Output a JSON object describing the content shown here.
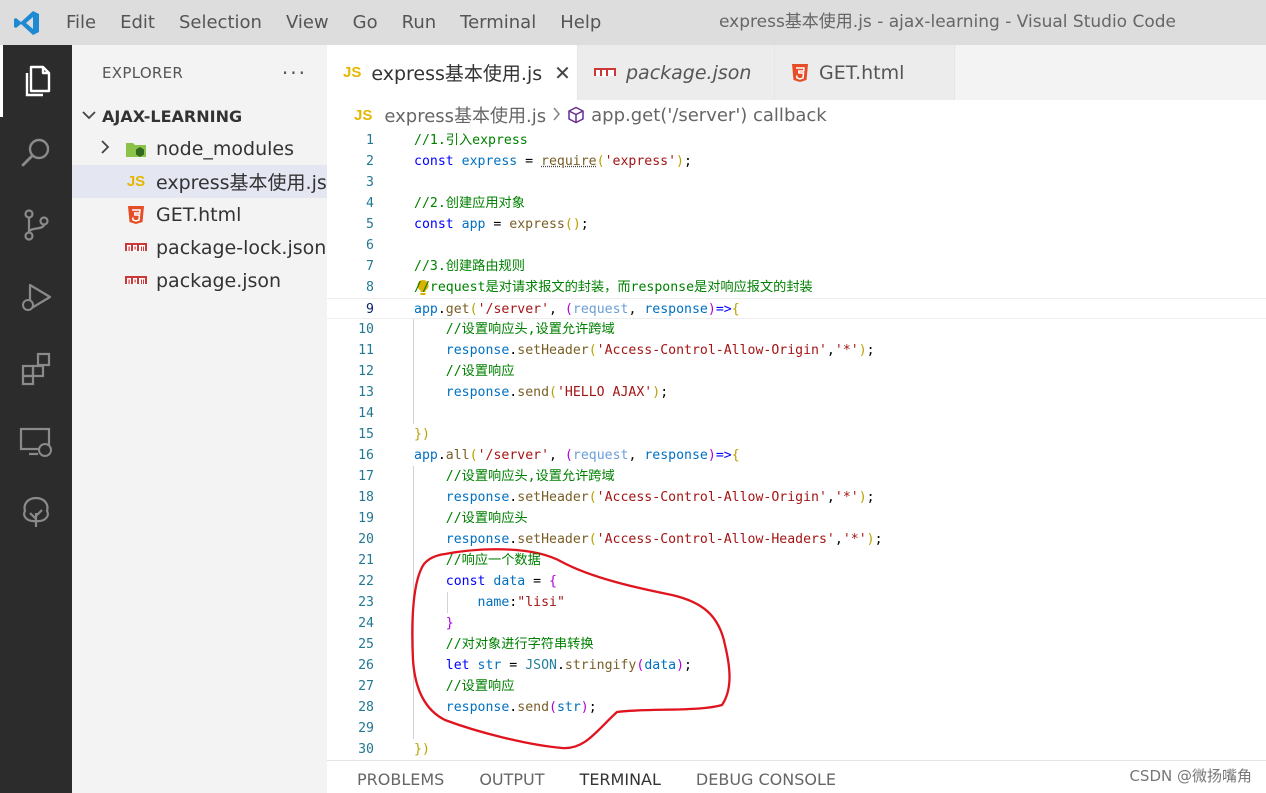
{
  "titlebar": {
    "menu": [
      "File",
      "Edit",
      "Selection",
      "View",
      "Go",
      "Run",
      "Terminal",
      "Help"
    ],
    "window_title": "express基本使用.js - ajax-learning - Visual Studio Code"
  },
  "activitybar": {
    "icons": [
      "explorer-icon",
      "search-icon",
      "source-control-icon",
      "run-debug-icon",
      "extensions-icon",
      "remote-explorer-icon",
      "tree-icon"
    ]
  },
  "sidebar": {
    "title": "EXPLORER",
    "more": "···",
    "folder": "AJAX-LEARNING",
    "items": [
      {
        "name": "node_modules",
        "icon": "node-folder-icon"
      },
      {
        "name": "express基本使用.js",
        "icon": "js-file-icon"
      },
      {
        "name": "GET.html",
        "icon": "html5-icon"
      },
      {
        "name": "package-lock.json",
        "icon": "npm-icon"
      },
      {
        "name": "package.json",
        "icon": "npm-icon"
      }
    ]
  },
  "tabs": [
    {
      "label": "express基本使用.js",
      "icon": "js-file-icon",
      "close": "✕"
    },
    {
      "label": "package.json",
      "icon": "npm-icon"
    },
    {
      "label": "GET.html",
      "icon": "html5-icon"
    }
  ],
  "breadcrumb": {
    "file": "express基本使用.js",
    "symbol": "app.get('/server') callback"
  },
  "editor": {
    "current_line": 9,
    "lines": [
      {
        "n": "1",
        "tokens": [
          [
            "c",
            "//1.引入express"
          ]
        ]
      },
      {
        "n": "2",
        "tokens": [
          [
            "k",
            "const "
          ],
          [
            "v",
            "express"
          ],
          [
            "o",
            " = "
          ],
          [
            "f",
            "require"
          ],
          [
            "br",
            "("
          ],
          [
            "s",
            "'express'"
          ],
          [
            "br",
            ")"
          ],
          [
            "o",
            ";"
          ]
        ]
      },
      {
        "n": "3",
        "tokens": []
      },
      {
        "n": "4",
        "tokens": [
          [
            "c",
            "//2.创建应用对象"
          ]
        ]
      },
      {
        "n": "5",
        "tokens": [
          [
            "k",
            "const "
          ],
          [
            "v",
            "app"
          ],
          [
            "o",
            " = "
          ],
          [
            "f",
            "express"
          ],
          [
            "br",
            "()"
          ],
          [
            "o",
            ";"
          ]
        ]
      },
      {
        "n": "6",
        "tokens": []
      },
      {
        "n": "7",
        "tokens": [
          [
            "c",
            "//3.创建路由规则"
          ]
        ]
      },
      {
        "n": "8",
        "tokens": [
          [
            "c",
            "//request是对请求报文的封装，而response是对响应报文的封装"
          ]
        ]
      },
      {
        "n": "9",
        "tokens": [
          [
            "v",
            "app"
          ],
          [
            "o",
            "."
          ],
          [
            "f",
            "get"
          ],
          [
            "br",
            "("
          ],
          [
            "s",
            "'/server'"
          ],
          [
            "o",
            ", "
          ],
          [
            "bp",
            "("
          ],
          [
            "p",
            "request"
          ],
          [
            "o",
            ", "
          ],
          [
            "v",
            "response"
          ],
          [
            "bp",
            ")"
          ],
          [
            "k",
            "=>"
          ],
          [
            "br",
            "{"
          ]
        ]
      },
      {
        "n": "10",
        "tokens": [
          [
            "o",
            "    "
          ],
          [
            "c",
            "//设置响应头,设置允许跨域"
          ]
        ]
      },
      {
        "n": "11",
        "tokens": [
          [
            "o",
            "    "
          ],
          [
            "v",
            "response"
          ],
          [
            "o",
            "."
          ],
          [
            "f",
            "setHeader"
          ],
          [
            "br",
            "("
          ],
          [
            "s",
            "'Access-Control-Allow-Origin'"
          ],
          [
            "o",
            ","
          ],
          [
            "s",
            "'*'"
          ],
          [
            "br",
            ")"
          ],
          [
            "o",
            ";"
          ]
        ]
      },
      {
        "n": "12",
        "tokens": [
          [
            "o",
            "    "
          ],
          [
            "c",
            "//设置响应"
          ]
        ]
      },
      {
        "n": "13",
        "tokens": [
          [
            "o",
            "    "
          ],
          [
            "v",
            "response"
          ],
          [
            "o",
            "."
          ],
          [
            "f",
            "send"
          ],
          [
            "br",
            "("
          ],
          [
            "s",
            "'HELLO AJAX'"
          ],
          [
            "br",
            ")"
          ],
          [
            "o",
            ";"
          ]
        ]
      },
      {
        "n": "14",
        "tokens": []
      },
      {
        "n": "15",
        "tokens": [
          [
            "br",
            "})"
          ]
        ]
      },
      {
        "n": "16",
        "tokens": [
          [
            "v",
            "app"
          ],
          [
            "o",
            "."
          ],
          [
            "f",
            "all"
          ],
          [
            "br",
            "("
          ],
          [
            "s",
            "'/server'"
          ],
          [
            "o",
            ", "
          ],
          [
            "bp",
            "("
          ],
          [
            "p",
            "request"
          ],
          [
            "o",
            ", "
          ],
          [
            "v",
            "response"
          ],
          [
            "bp",
            ")"
          ],
          [
            "k",
            "=>"
          ],
          [
            "br",
            "{"
          ]
        ]
      },
      {
        "n": "17",
        "tokens": [
          [
            "o",
            "    "
          ],
          [
            "c",
            "//设置响应头,设置允许跨域"
          ]
        ]
      },
      {
        "n": "18",
        "tokens": [
          [
            "o",
            "    "
          ],
          [
            "v",
            "response"
          ],
          [
            "o",
            "."
          ],
          [
            "f",
            "setHeader"
          ],
          [
            "br",
            "("
          ],
          [
            "s",
            "'Access-Control-Allow-Origin'"
          ],
          [
            "o",
            ","
          ],
          [
            "s",
            "'*'"
          ],
          [
            "br",
            ")"
          ],
          [
            "o",
            ";"
          ]
        ]
      },
      {
        "n": "19",
        "tokens": [
          [
            "o",
            "    "
          ],
          [
            "c",
            "//设置响应头"
          ]
        ]
      },
      {
        "n": "20",
        "tokens": [
          [
            "o",
            "    "
          ],
          [
            "v",
            "response"
          ],
          [
            "o",
            "."
          ],
          [
            "f",
            "setHeader"
          ],
          [
            "br",
            "("
          ],
          [
            "s",
            "'Access-Control-Allow-Headers'"
          ],
          [
            "o",
            ","
          ],
          [
            "s",
            "'*'"
          ],
          [
            "br",
            ")"
          ],
          [
            "o",
            ";"
          ]
        ]
      },
      {
        "n": "21",
        "tokens": [
          [
            "o",
            "    "
          ],
          [
            "c",
            "//响应一个数据"
          ]
        ]
      },
      {
        "n": "22",
        "tokens": [
          [
            "o",
            "    "
          ],
          [
            "k",
            "const "
          ],
          [
            "v",
            "data"
          ],
          [
            "o",
            " = "
          ],
          [
            "bp",
            "{"
          ]
        ]
      },
      {
        "n": "23",
        "tokens": [
          [
            "o",
            "        "
          ],
          [
            "v",
            "name"
          ],
          [
            "o",
            ":"
          ],
          [
            "s",
            "\"lisi\""
          ]
        ]
      },
      {
        "n": "24",
        "tokens": [
          [
            "o",
            "    "
          ],
          [
            "bp",
            "}"
          ]
        ]
      },
      {
        "n": "25",
        "tokens": [
          [
            "o",
            "    "
          ],
          [
            "c",
            "//对对象进行字符串转换"
          ]
        ]
      },
      {
        "n": "26",
        "tokens": [
          [
            "o",
            "    "
          ],
          [
            "k",
            "let "
          ],
          [
            "v",
            "str"
          ],
          [
            "o",
            " = "
          ],
          [
            "t",
            "JSON"
          ],
          [
            "o",
            "."
          ],
          [
            "f",
            "stringify"
          ],
          [
            "bp",
            "("
          ],
          [
            "v",
            "data"
          ],
          [
            "bp",
            ")"
          ],
          [
            "o",
            ";"
          ]
        ]
      },
      {
        "n": "27",
        "tokens": [
          [
            "o",
            "    "
          ],
          [
            "c",
            "//设置响应"
          ]
        ]
      },
      {
        "n": "28",
        "tokens": [
          [
            "o",
            "    "
          ],
          [
            "v",
            "response"
          ],
          [
            "o",
            "."
          ],
          [
            "f",
            "send"
          ],
          [
            "bp",
            "("
          ],
          [
            "v",
            "str"
          ],
          [
            "bp",
            ")"
          ],
          [
            "o",
            ";"
          ]
        ]
      },
      {
        "n": "29",
        "tokens": []
      },
      {
        "n": "30",
        "tokens": [
          [
            "br",
            "})"
          ]
        ]
      }
    ]
  },
  "panel": {
    "tabs": [
      "PROBLEMS",
      "OUTPUT",
      "TERMINAL",
      "DEBUG CONSOLE"
    ],
    "active": "TERMINAL"
  },
  "watermark": "CSDN @微扬嘴角",
  "colors": {
    "activitybar": "#2c2c2c",
    "titlebar": "#dddddd",
    "sidebar": "#f3f3f3",
    "js_yellow": "#e5b700",
    "html_orange": "#e44d26",
    "npm_red": "#cb3837",
    "annotation_red": "#e0141e"
  }
}
